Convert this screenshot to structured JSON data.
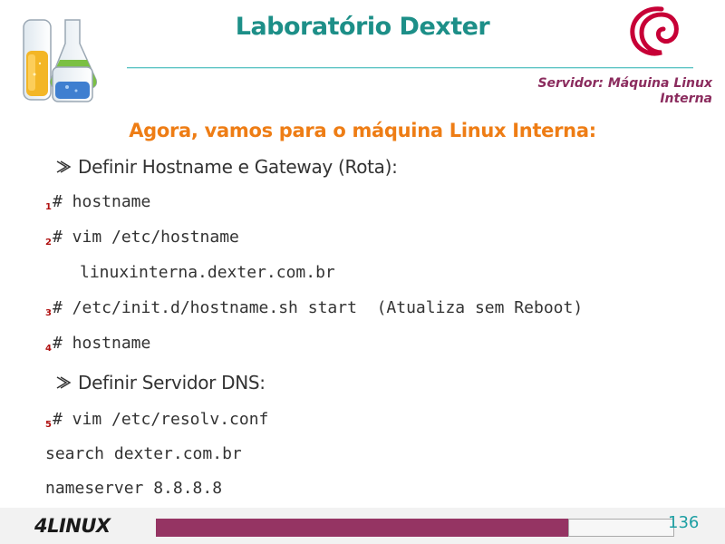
{
  "header": {
    "title": "Laboratório Dexter",
    "section": [
      "Servidor: Máquina Linux",
      "Interna"
    ]
  },
  "content": {
    "heading": "Agora, vamos para o máquina Linux Interna:",
    "bullets": [
      "Definir Hostname e Gateway (Rota):",
      "Definir Servidor DNS:"
    ],
    "steps": [
      {
        "num": "1",
        "cmd": "# hostname"
      },
      {
        "num": "2",
        "cmd": "# vim /etc/hostname"
      },
      {
        "num": "3",
        "cmd": "# /etc/init.d/hostname.sh start  (Atualiza sem Reboot)"
      },
      {
        "num": "4",
        "cmd": "# hostname"
      },
      {
        "num": "5",
        "cmd": "# vim /etc/resolv.conf"
      }
    ],
    "hostname_content": "linuxinterna.dexter.com.br",
    "resolv_lines": [
      "search dexter.com.br",
      "nameserver 8.8.8.8"
    ]
  },
  "footer": {
    "logo": "4LINUX",
    "page_number": "136"
  },
  "colors": {
    "title": "#1d8f88",
    "heading": "#ee7d15",
    "section_label": "#8b2c5e",
    "footer_bar": "#953463"
  },
  "icons": {
    "lab_logo": "lab-flask-icon",
    "debian_logo": "debian-swirl-icon",
    "bullet": "arrow-bullet-icon"
  }
}
